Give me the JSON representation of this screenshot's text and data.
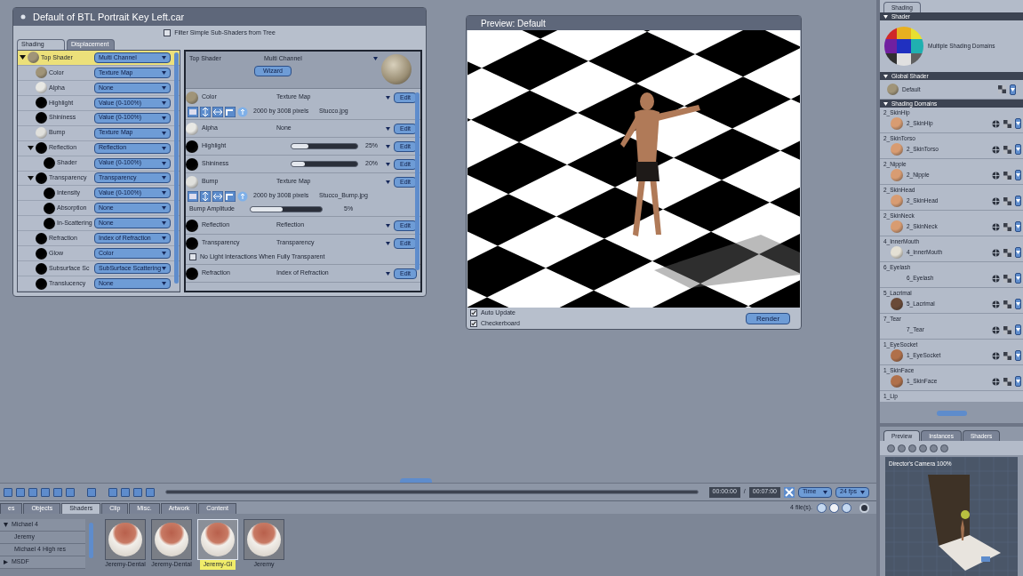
{
  "shader_window": {
    "title": "Default of BTL Portrait Key Left.car",
    "filter": {
      "label": "Filter Simple Sub-Shaders from Tree",
      "checked": false
    },
    "tabs": [
      {
        "label": "Shading",
        "selected": true
      },
      {
        "label": "Displacement",
        "selected": false
      }
    ],
    "tree": [
      {
        "name": "Top Shader",
        "value": "Multi Channel",
        "color": "#a09478",
        "selected": true,
        "expanded": true,
        "children": [
          {
            "name": "Color",
            "value": "Texture Map",
            "color": "#a09478",
            "selected": false
          },
          {
            "name": "Alpha",
            "value": "None",
            "color": "#e8e8e4",
            "selected": false
          },
          {
            "name": "Highlight",
            "value": "Value (0-100%)",
            "color": "#000000",
            "selected": false
          },
          {
            "name": "Shininess",
            "value": "Value (0-100%)",
            "color": "#000000",
            "selected": false
          },
          {
            "name": "Bump",
            "value": "Texture Map",
            "color": "#e0e0dc",
            "selected": false
          },
          {
            "name": "Reflection",
            "value": "Reflection",
            "color": "#000000",
            "selected": false,
            "expanded": true,
            "children": [
              {
                "name": "Shader",
                "value": "Value (0-100%)",
                "color": "#000000",
                "selected": false
              }
            ]
          },
          {
            "name": "Transparency",
            "value": "Transparency",
            "color": "#000000",
            "selected": false,
            "expanded": true,
            "children": [
              {
                "name": "Intensity",
                "value": "Value (0-100%)",
                "color": "#000000",
                "selected": false
              },
              {
                "name": "Absorption",
                "value": "None",
                "color": "#000000",
                "selected": false
              },
              {
                "name": "In-Scattering",
                "value": "None",
                "color": "#000000",
                "selected": false
              }
            ]
          },
          {
            "name": "Refraction",
            "value": "Index of Refraction",
            "color": "#000000",
            "selected": false
          },
          {
            "name": "Glow",
            "value": "Color",
            "color": "#000000",
            "selected": false
          },
          {
            "name": "Subsurface Sc",
            "value": "SubSurface Scattering",
            "color": "#000000",
            "selected": false
          },
          {
            "name": "Translucency",
            "value": "None",
            "color": "#000000",
            "selected": false
          }
        ]
      }
    ],
    "detail": {
      "header": {
        "name": "Top Shader",
        "value": "Multi Channel",
        "button": "Wizard"
      },
      "channels": [
        {
          "kind": "texture",
          "name": "Color",
          "color": "#a09478",
          "value": "Texture Map",
          "size": "2000 by 3008 pixels",
          "file": "Stucco.jpg",
          "button": "Edit"
        },
        {
          "kind": "plain",
          "name": "Alpha",
          "color": "#e8e8e4",
          "value": "None",
          "button": "Edit"
        },
        {
          "kind": "slider",
          "name": "Highlight",
          "color": "#000000",
          "level": 0.25,
          "reading": "25%",
          "button": "Edit"
        },
        {
          "kind": "slider",
          "name": "Shininess",
          "color": "#000000",
          "level": 0.2,
          "reading": "20%",
          "button": "Edit"
        },
        {
          "kind": "texture",
          "name": "Bump",
          "color": "#e0e0dc",
          "value": "Texture Map",
          "size": "2000 by 3008 pixels",
          "file": "Stucco_Bump.jpg",
          "button": "Edit",
          "amplitude": {
            "label": "Bump Amplitude",
            "level": 0.45,
            "reading": "5%"
          }
        },
        {
          "kind": "plain",
          "name": "Reflection",
          "color": "#000000",
          "value": "Reflection",
          "button": "Edit"
        },
        {
          "kind": "plain",
          "name": "Transparency",
          "color": "#000000",
          "value": "Transparency",
          "button": "Edit",
          "option": {
            "label": "No Light Interactions When Fully Transparent",
            "checked": false
          }
        },
        {
          "kind": "plain",
          "name": "Refraction",
          "color": "#000000",
          "value": "Index of Refraction",
          "button": "Edit"
        }
      ]
    }
  },
  "preview_window": {
    "title": "Preview: Default",
    "options": [
      {
        "label": "Auto Update",
        "checked": true
      },
      {
        "label": "Checkerboard",
        "checked": true
      }
    ],
    "button": "Render"
  },
  "timeline": {
    "current": "00:00:00",
    "separator": "/",
    "end": "00:07:00",
    "mode": "Time",
    "fps": "24 fps"
  },
  "library": {
    "tabs": [
      {
        "label": "es",
        "selected": false
      },
      {
        "label": "Objects",
        "selected": false
      },
      {
        "label": "Shaders",
        "selected": true
      },
      {
        "label": "Clip",
        "selected": false
      },
      {
        "label": "Misc.",
        "selected": false
      },
      {
        "label": "Artwork",
        "selected": false
      },
      {
        "label": "Content",
        "selected": false
      }
    ],
    "count": "4 file(s).",
    "tree": [
      {
        "name": "Michael 4",
        "expanded": true,
        "children": [
          {
            "name": "Jeremy"
          },
          {
            "name": "Michael 4 High res"
          }
        ]
      },
      {
        "name": "MSDF",
        "expanded": false
      }
    ],
    "thumbnails": [
      {
        "label": "Jeremy-Dental",
        "selected": false
      },
      {
        "label": "Jeremy-Dental",
        "selected": false
      },
      {
        "label": "Jeremy-Gl",
        "selected": true
      },
      {
        "label": "Jeremy",
        "selected": false
      }
    ]
  },
  "shading_panel": {
    "tab": "Shading",
    "shader": {
      "title": "Shader",
      "label": "Multiple Shading Domains"
    },
    "global": {
      "title": "Global Shader",
      "name": "Default",
      "color": "#a09478"
    },
    "domains": {
      "title": "Shading Domains",
      "items": [
        {
          "group": "2_SkinHip",
          "name": "2_SkinHip",
          "color": "#d89c72"
        },
        {
          "group": "2_SkinTorso",
          "name": "2_SkinTorso",
          "color": "#d89c72"
        },
        {
          "group": "2_Nipple",
          "name": "2_Nipple",
          "color": "#d89c72"
        },
        {
          "group": "2_SkinHead",
          "name": "2_SkinHead",
          "color": "#d89c72"
        },
        {
          "group": "2_SkinNeck",
          "name": "2_SkinNeck",
          "color": "#d89c72"
        },
        {
          "group": "4_InnerMouth",
          "name": "4_InnerMouth",
          "color": "#e4e0d4"
        },
        {
          "group": "6_Eyelash",
          "name": "6_Eyelash"
        },
        {
          "group": "5_Lacrimal",
          "name": "5_Lacrimal",
          "color": "#6a4a38"
        },
        {
          "group": "7_Tear",
          "name": "7_Tear"
        },
        {
          "group": "1_EyeSocket",
          "name": "1_EyeSocket",
          "color": "#b0704a"
        },
        {
          "group": "1_SkinFace",
          "name": "1_SkinFace",
          "color": "#b0704a"
        },
        {
          "group": "1_Lip"
        }
      ]
    }
  },
  "preview_panel": {
    "tabs": [
      {
        "label": "Preview",
        "selected": true
      },
      {
        "label": "Instances",
        "selected": false
      },
      {
        "label": "Shaders",
        "selected": false
      }
    ],
    "viewport": {
      "label": "Director's Camera 100%"
    }
  }
}
